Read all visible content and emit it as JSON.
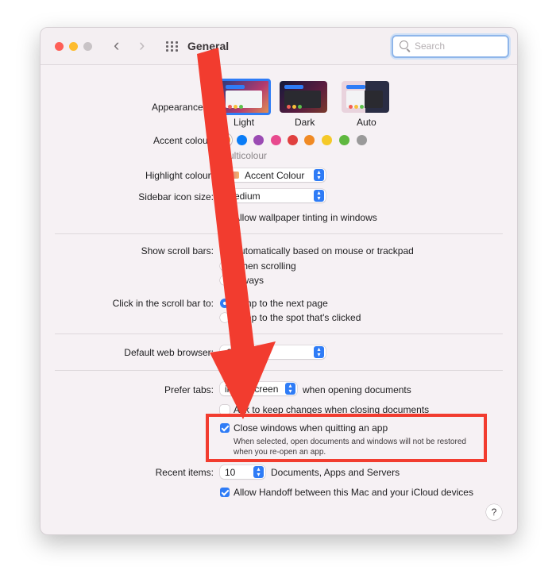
{
  "window": {
    "title": "General"
  },
  "search": {
    "placeholder": "Search"
  },
  "appearance": {
    "label": "Appearance:",
    "options": [
      {
        "label": "Light",
        "selected": true
      },
      {
        "label": "Dark",
        "selected": false
      },
      {
        "label": "Auto",
        "selected": false
      }
    ]
  },
  "accent": {
    "label": "Accent colour:",
    "selected_caption": "Multicolour",
    "swatches": [
      "#multicolour",
      "#0a7cf6",
      "#9b4bb3",
      "#e84a8e",
      "#e0403f",
      "#f08a24",
      "#f5c928",
      "#5fb83f",
      "#9a9a9a"
    ]
  },
  "highlight": {
    "label": "Highlight colour:",
    "value": "Accent Colour"
  },
  "sidebar_icon": {
    "label": "Sidebar icon size:",
    "value": "Medium"
  },
  "wallpaper_tinting": {
    "label": "Allow wallpaper tinting in windows",
    "checked": false
  },
  "scroll_bars": {
    "label": "Show scroll bars:",
    "options": [
      {
        "label": "Automatically based on mouse or trackpad",
        "selected": true
      },
      {
        "label": "When scrolling",
        "selected": false
      },
      {
        "label": "Always",
        "selected": false
      }
    ]
  },
  "click_scroll": {
    "label": "Click in the scroll bar to:",
    "options": [
      {
        "label": "Jump to the next page",
        "selected": true
      },
      {
        "label": "Jump to the spot that's clicked",
        "selected": false
      }
    ]
  },
  "browser": {
    "label": "Default web browser:",
    "value": "Safari"
  },
  "prefer_tabs": {
    "label": "Prefer tabs:",
    "value": "in full screen",
    "suffix": "when opening documents"
  },
  "ask_keep": {
    "label": "Ask to keep changes when closing documents",
    "checked": false
  },
  "close_windows": {
    "label": "Close windows when quitting an app",
    "checked": true,
    "desc_line1": "When selected, open documents and windows will not be restored",
    "desc_line2": "when you re-open an app."
  },
  "recent_items": {
    "label": "Recent items:",
    "value": "10",
    "suffix": "Documents, Apps and Servers"
  },
  "handoff": {
    "label": "Allow Handoff between this Mac and your iCloud devices",
    "checked": true
  },
  "help": {
    "label": "?"
  },
  "colors": {
    "accent_blue": "#2f7cf6",
    "annotation_red": "#f23c2f"
  }
}
